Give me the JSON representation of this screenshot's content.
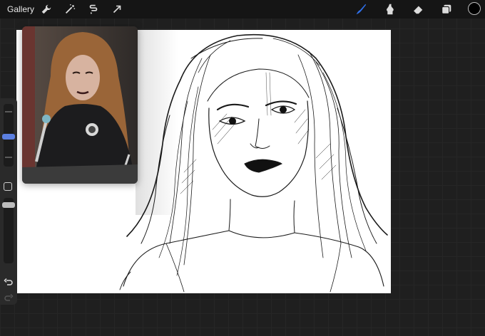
{
  "app": {
    "gallery_label": "Gallery"
  },
  "toolbar": {
    "left_tools": [
      {
        "name": "wrench-icon"
      },
      {
        "name": "magic-wand-icon"
      },
      {
        "name": "selection-icon"
      },
      {
        "name": "transform-arrow-icon"
      }
    ],
    "right_tools": [
      {
        "name": "brush-icon",
        "active": true,
        "color": "#2f6fe8"
      },
      {
        "name": "smudge-icon",
        "active": false
      },
      {
        "name": "eraser-icon",
        "active": false
      },
      {
        "name": "layers-icon",
        "active": false
      }
    ],
    "current_color": "#000000"
  },
  "sidebar": {
    "brush_size_level": 0.5,
    "opacity_level": 0.9,
    "accent_color": "#5b7fe0"
  },
  "colors": {
    "canvas_bg": "#ffffff",
    "workspace_bg": "#1f1f1f"
  }
}
